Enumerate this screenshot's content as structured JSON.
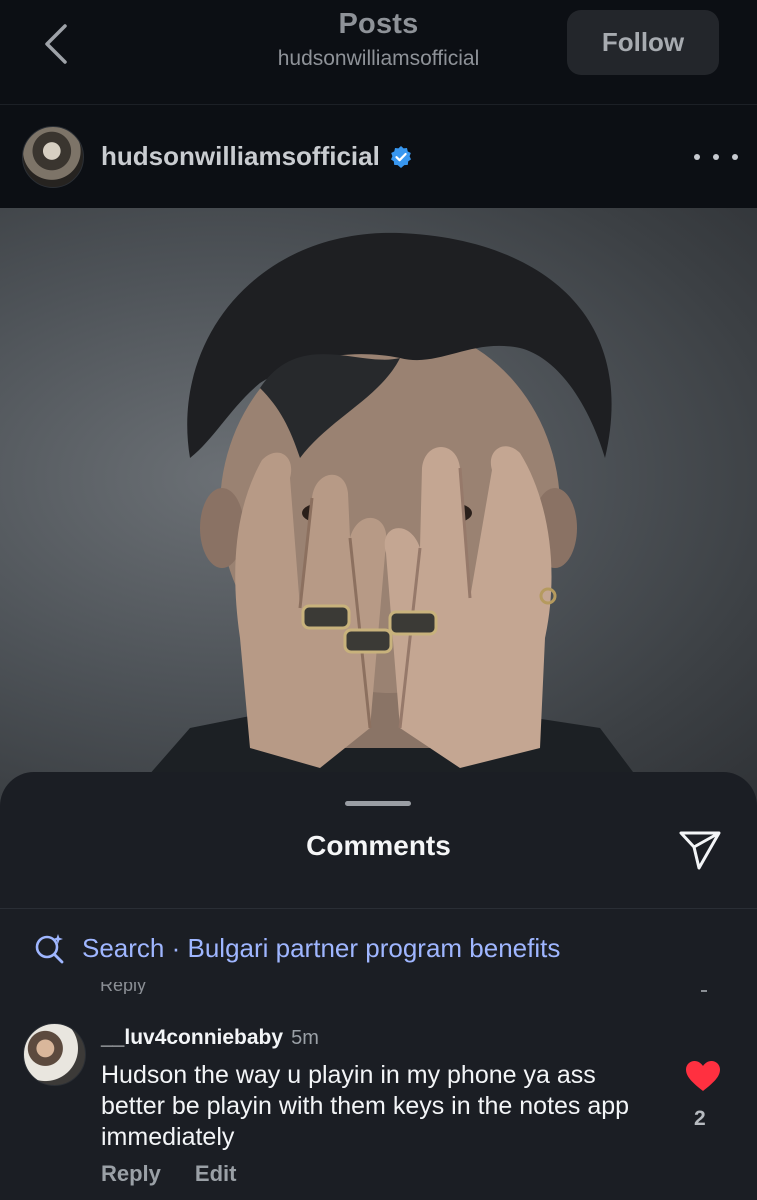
{
  "header": {
    "title": "Posts",
    "subtitle": "hudsonwilliamsofficial",
    "follow_label": "Follow"
  },
  "post": {
    "username": "hudsonwilliamsofficial",
    "verified": true,
    "photo_description": "portrait of a man covering his face with both hands, wearing rings"
  },
  "comments_sheet": {
    "title": "Comments",
    "search_label": "Search · Bulgari partner program benefits",
    "partial_reply_label": "Reply",
    "comment": {
      "username": "__luv4conniebaby",
      "time": "5m",
      "text": "Hudson the way u playin in my phone ya ass better be playin with them keys in the notes app immediately",
      "likes": "2",
      "reply_label": "Reply",
      "edit_label": "Edit"
    }
  },
  "colors": {
    "background": "#0c0f14",
    "sheet": "#1b1e24",
    "accent_link": "#9fb6ff",
    "verified": "#3897f0",
    "heart": "#ff3040"
  }
}
